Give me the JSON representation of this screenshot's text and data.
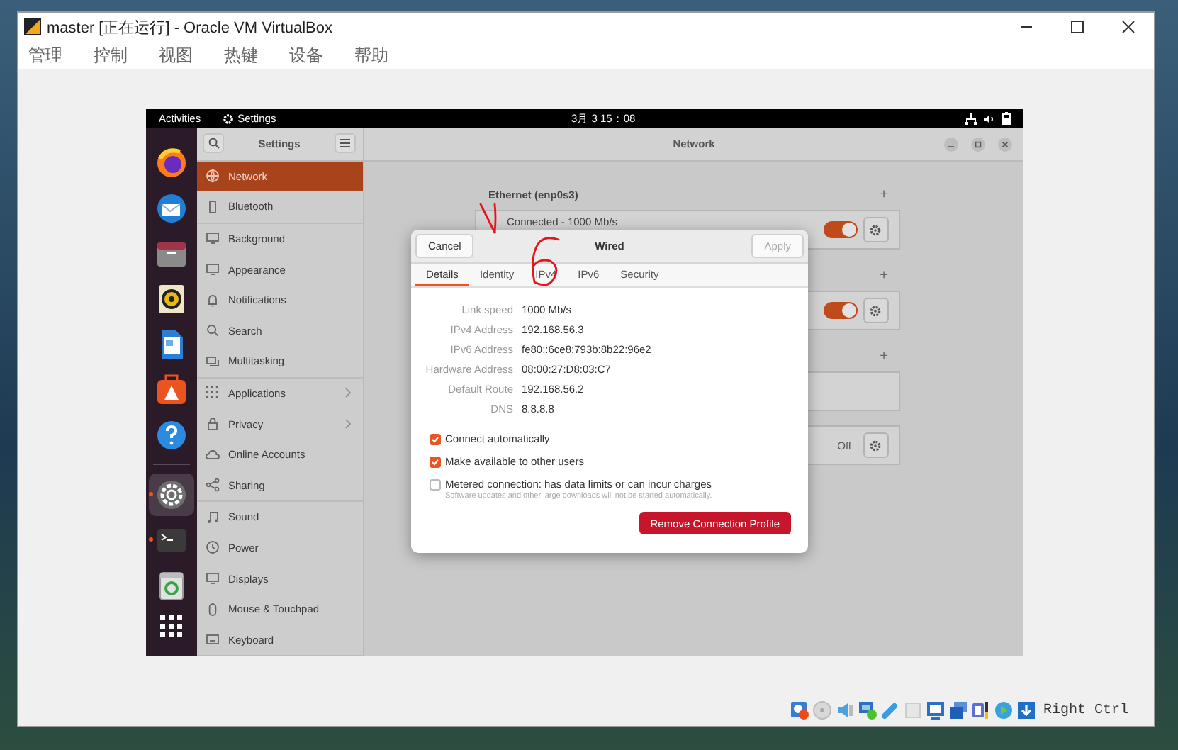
{
  "window": {
    "title": "master [正在运行] - Oracle VM VirtualBox"
  },
  "menu": [
    "管理",
    "控制",
    "视图",
    "热键",
    "设备",
    "帮助"
  ],
  "guest": {
    "top_bar": {
      "activities": "Activities",
      "app": "Settings",
      "clock": "3月 3 15：08"
    },
    "dock": {
      "groups": [
        [
          {
            "running": false,
            "selected": false
          },
          {
            "running": false,
            "selected": false
          },
          {
            "running": false,
            "selected": false
          },
          {
            "running": false,
            "selected": false
          },
          {
            "running": false,
            "selected": false
          },
          {
            "running": false,
            "selected": false
          },
          {
            "running": false,
            "selected": false
          }
        ],
        [
          {
            "running": true,
            "selected": true
          },
          {
            "running": true,
            "selected": false
          },
          {
            "running": false,
            "selected": false
          }
        ]
      ]
    },
    "settings": {
      "title": "Settings",
      "groups": [
        [
          {
            "label": "Network",
            "selected": true,
            "submenu": false
          },
          {
            "label": "Bluetooth",
            "selected": false,
            "submenu": false
          }
        ],
        [
          {
            "label": "Background",
            "selected": false,
            "submenu": false
          },
          {
            "label": "Appearance",
            "selected": false,
            "submenu": false
          },
          {
            "label": "Notifications",
            "selected": false,
            "submenu": false
          },
          {
            "label": "Search",
            "selected": false,
            "submenu": false
          },
          {
            "label": "Multitasking",
            "selected": false,
            "submenu": false
          }
        ],
        [
          {
            "label": "Applications",
            "selected": false,
            "submenu": true
          },
          {
            "label": "Privacy",
            "selected": false,
            "submenu": true
          },
          {
            "label": "Online Accounts",
            "selected": false,
            "submenu": false
          },
          {
            "label": "Sharing",
            "selected": false,
            "submenu": false
          }
        ],
        [
          {
            "label": "Sound",
            "selected": false,
            "submenu": false
          },
          {
            "label": "Power",
            "selected": false,
            "submenu": false
          },
          {
            "label": "Displays",
            "selected": false,
            "submenu": false
          },
          {
            "label": "Mouse & Touchpad",
            "selected": false,
            "submenu": false
          },
          {
            "label": "Keyboard",
            "selected": false,
            "submenu": false
          }
        ]
      ]
    },
    "network": {
      "title": "Network",
      "sections": [
        {
          "heading": "Ethernet (enp0s3)",
          "add": "+",
          "rows": [
            {
              "kind": "toggle",
              "label": "Connected - 1000 Mb/s",
              "on": true
            }
          ]
        },
        {
          "add": "+",
          "rows": [
            {
              "kind": "toggle",
              "on": true
            }
          ]
        },
        {
          "add": "+",
          "rows": [
            {
              "kind": "empty"
            }
          ]
        },
        {
          "rows": [
            {
              "kind": "status",
              "status": "Off"
            }
          ]
        }
      ]
    },
    "dialog": {
      "title": "Wired",
      "cancel": "Cancel",
      "apply": {
        "label": "Apply",
        "disabled": true
      },
      "tabs": [
        {
          "label": "Details",
          "selected": true
        },
        {
          "label": "Identity",
          "selected": false
        },
        {
          "label": "IPv4",
          "selected": false
        },
        {
          "label": "IPv6",
          "selected": false
        },
        {
          "label": "Security",
          "selected": false
        }
      ],
      "details": [
        {
          "label": "Link speed",
          "value": "1000 Mb/s"
        },
        {
          "label": "IPv4 Address",
          "value": "192.168.56.3"
        },
        {
          "label": "IPv6 Address",
          "value": "fe80::6ce8:793b:8b22:96e2"
        },
        {
          "label": "Hardware Address",
          "value": "08:00:27:D8:03:C7"
        },
        {
          "label": "Default Route",
          "value": "192.168.56.2"
        },
        {
          "label": "DNS",
          "value": "8.8.8.8"
        }
      ],
      "options": [
        {
          "label": "Connect automatically",
          "checked": true
        },
        {
          "label": "Make available to other users",
          "checked": true
        },
        {
          "label": "Metered connection: has data limits or can incur charges",
          "hint": "Software updates and other large downloads will not be started automatically.",
          "checked": false
        }
      ],
      "remove": "Remove Connection Profile"
    }
  },
  "status_bar": {
    "host_key": "Right Ctrl"
  }
}
